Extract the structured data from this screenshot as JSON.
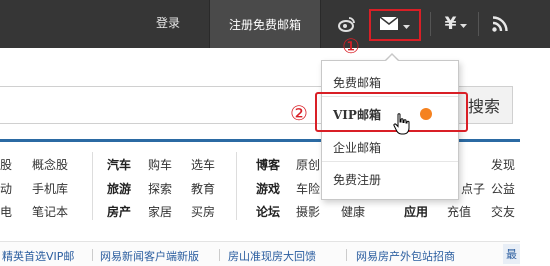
{
  "topbar": {
    "login_label": "登录",
    "register_label": "注册免费邮箱",
    "icons": [
      "weibo-icon",
      "mail-icon",
      "yen-icon",
      "rss-icon"
    ]
  },
  "annotations": {
    "marker_1": "①",
    "marker_2": "②"
  },
  "search": {
    "button_label": "搜索",
    "button_label_visible": "f索"
  },
  "dropdown": {
    "items": [
      "免费邮箱",
      "VIP邮箱",
      "企业邮箱",
      "免费注册"
    ]
  },
  "nav": {
    "col1": [
      "股",
      "动",
      "电"
    ],
    "col2": [
      "概念股",
      "手机库",
      "笔记本"
    ],
    "col3": [
      "汽车",
      "旅游",
      "房产"
    ],
    "col4": [
      "购车",
      "探索",
      "家居"
    ],
    "col5": [
      "选车",
      "教育",
      "买房"
    ],
    "col6": [
      "博客",
      "游戏",
      "论坛"
    ],
    "col7": [
      "原创",
      "车险",
      "摄影"
    ],
    "col8": [
      "",
      "",
      "健康"
    ],
    "col9": [
      "",
      "",
      "应用"
    ],
    "col10": [
      "",
      "",
      "充值"
    ],
    "col11": [
      "",
      "点子",
      "交友"
    ],
    "col12": [
      "发现",
      "公益",
      ""
    ]
  },
  "bottom_links": {
    "items": [
      "精英首选VIP邮",
      "网易新闻客户端新版",
      "房山准现房大回馈",
      "网易房产外包站招商"
    ],
    "more": "最"
  },
  "colors": {
    "topbar": "#363636",
    "highlight_red": "#d91f26",
    "accent_orange": "#f58220",
    "link_blue": "#2a5d9f"
  }
}
